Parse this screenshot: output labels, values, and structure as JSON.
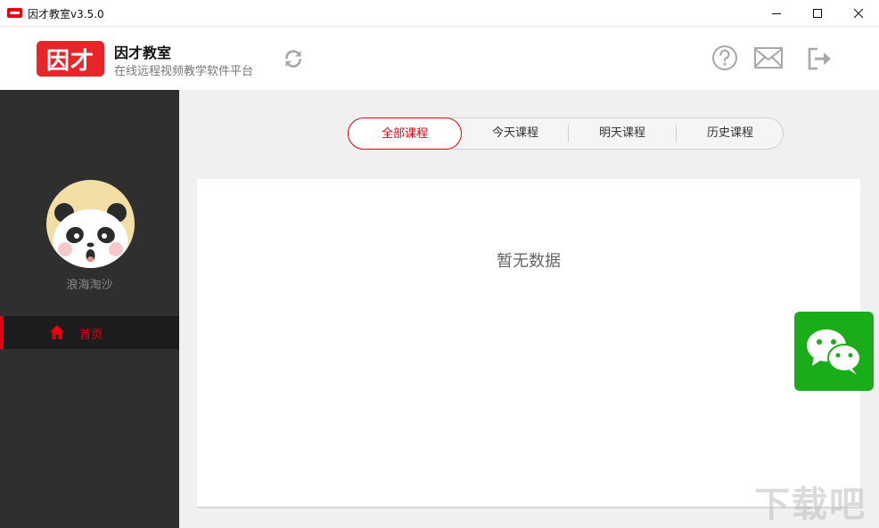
{
  "window": {
    "title": "因才教室v3.5.0",
    "controls": [
      "minimize",
      "maximize",
      "close"
    ]
  },
  "header": {
    "logo_text": "因才",
    "brand_name": "因才教室",
    "brand_tagline": "在线远程视频教学软件平台",
    "icons": [
      "refresh-icon",
      "help-icon",
      "mail-icon",
      "logout-icon"
    ]
  },
  "sidebar": {
    "username": "浪海淘沙",
    "nav": [
      {
        "label": "首页",
        "icon": "home-icon",
        "active": true
      }
    ]
  },
  "main": {
    "tabs": [
      {
        "label": "全部课程",
        "active": true
      },
      {
        "label": "今天课程",
        "active": false
      },
      {
        "label": "明天课程",
        "active": false
      },
      {
        "label": "历史课程",
        "active": false
      }
    ],
    "empty_text": "暂无数据"
  },
  "floating": {
    "wechat_icon": "wechat-icon"
  },
  "watermark": "下载吧",
  "colors": {
    "accent": "#e60012",
    "sidebar": "#2f2f2f",
    "wechat": "#1aad19"
  }
}
